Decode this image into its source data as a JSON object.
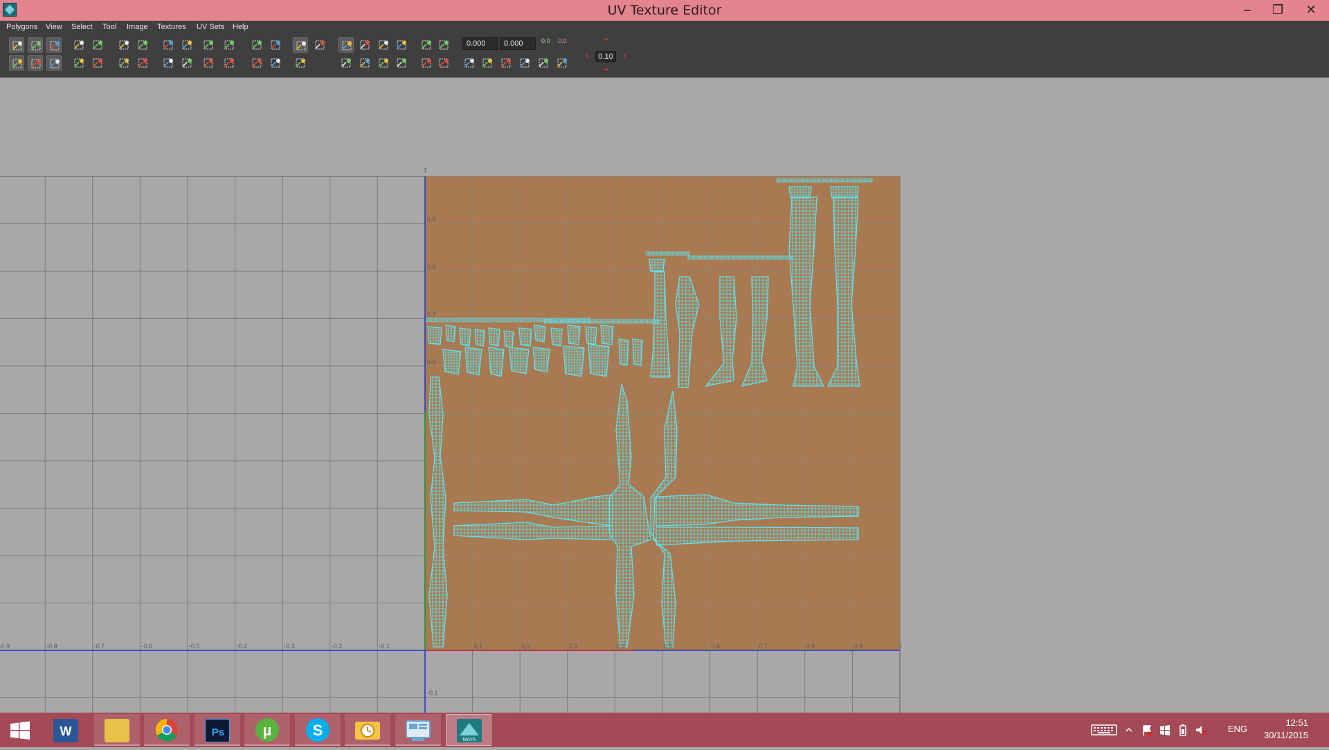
{
  "window": {
    "title": "UV Texture Editor",
    "minimize_glyph": "–",
    "restore_glyph": "❐",
    "close_glyph": "✕"
  },
  "menubar": {
    "items": [
      "Polygons",
      "View",
      "Select",
      "Tool",
      "Image",
      "Textures",
      "UV Sets",
      "Help"
    ]
  },
  "toolbar": {
    "u_value": "0.000",
    "v_value": "0.000",
    "step_value": "0.10",
    "field_label_a": "0.0",
    "field_label_b": "0.0"
  },
  "viewport": {
    "texture_color": "#a97a52",
    "grid_color": "#7a7a7a",
    "uv_color": "#5ee3f0",
    "axis_u_color": "#e02020",
    "axis_v_color": "#1fa51f",
    "axis_major_color": "#1f2fd0",
    "top_label": "1",
    "bottom_label": "-0.1",
    "negative_ticks": [
      "-0.9",
      "-0.8",
      "-0.7",
      "-0.6",
      "-0.5",
      "-0.4",
      "-0.3",
      "-0.2",
      "-0.1"
    ],
    "positive_ticks": [
      "0.1",
      "0.2",
      "0.3",
      "0.4",
      "0.5",
      "0.6",
      "0.7",
      "0.8",
      "0.9",
      "1"
    ],
    "v_ticks": [
      "0.9",
      "0.8",
      "0.7",
      "0.6"
    ]
  },
  "taskbar": {
    "apps": [
      {
        "name": "windows-start",
        "color": "#ffffff"
      },
      {
        "name": "word",
        "color": "#2b5797"
      },
      {
        "name": "file-explorer",
        "color": "#e8c14a"
      },
      {
        "name": "chrome",
        "color": "#db4437"
      },
      {
        "name": "photoshop",
        "color": "#0b1a33"
      },
      {
        "name": "utorrent",
        "color": "#59b33c"
      },
      {
        "name": "skype",
        "color": "#00aff0"
      },
      {
        "name": "outlook-sticky",
        "color": "#f4c542"
      },
      {
        "name": "control-panel",
        "color": "#6aa3d8"
      },
      {
        "name": "maya",
        "color": "#1c7a80"
      }
    ],
    "maya_label": "MAYA",
    "language": "ENG",
    "time": "12:51",
    "date": "30/11/2015"
  }
}
